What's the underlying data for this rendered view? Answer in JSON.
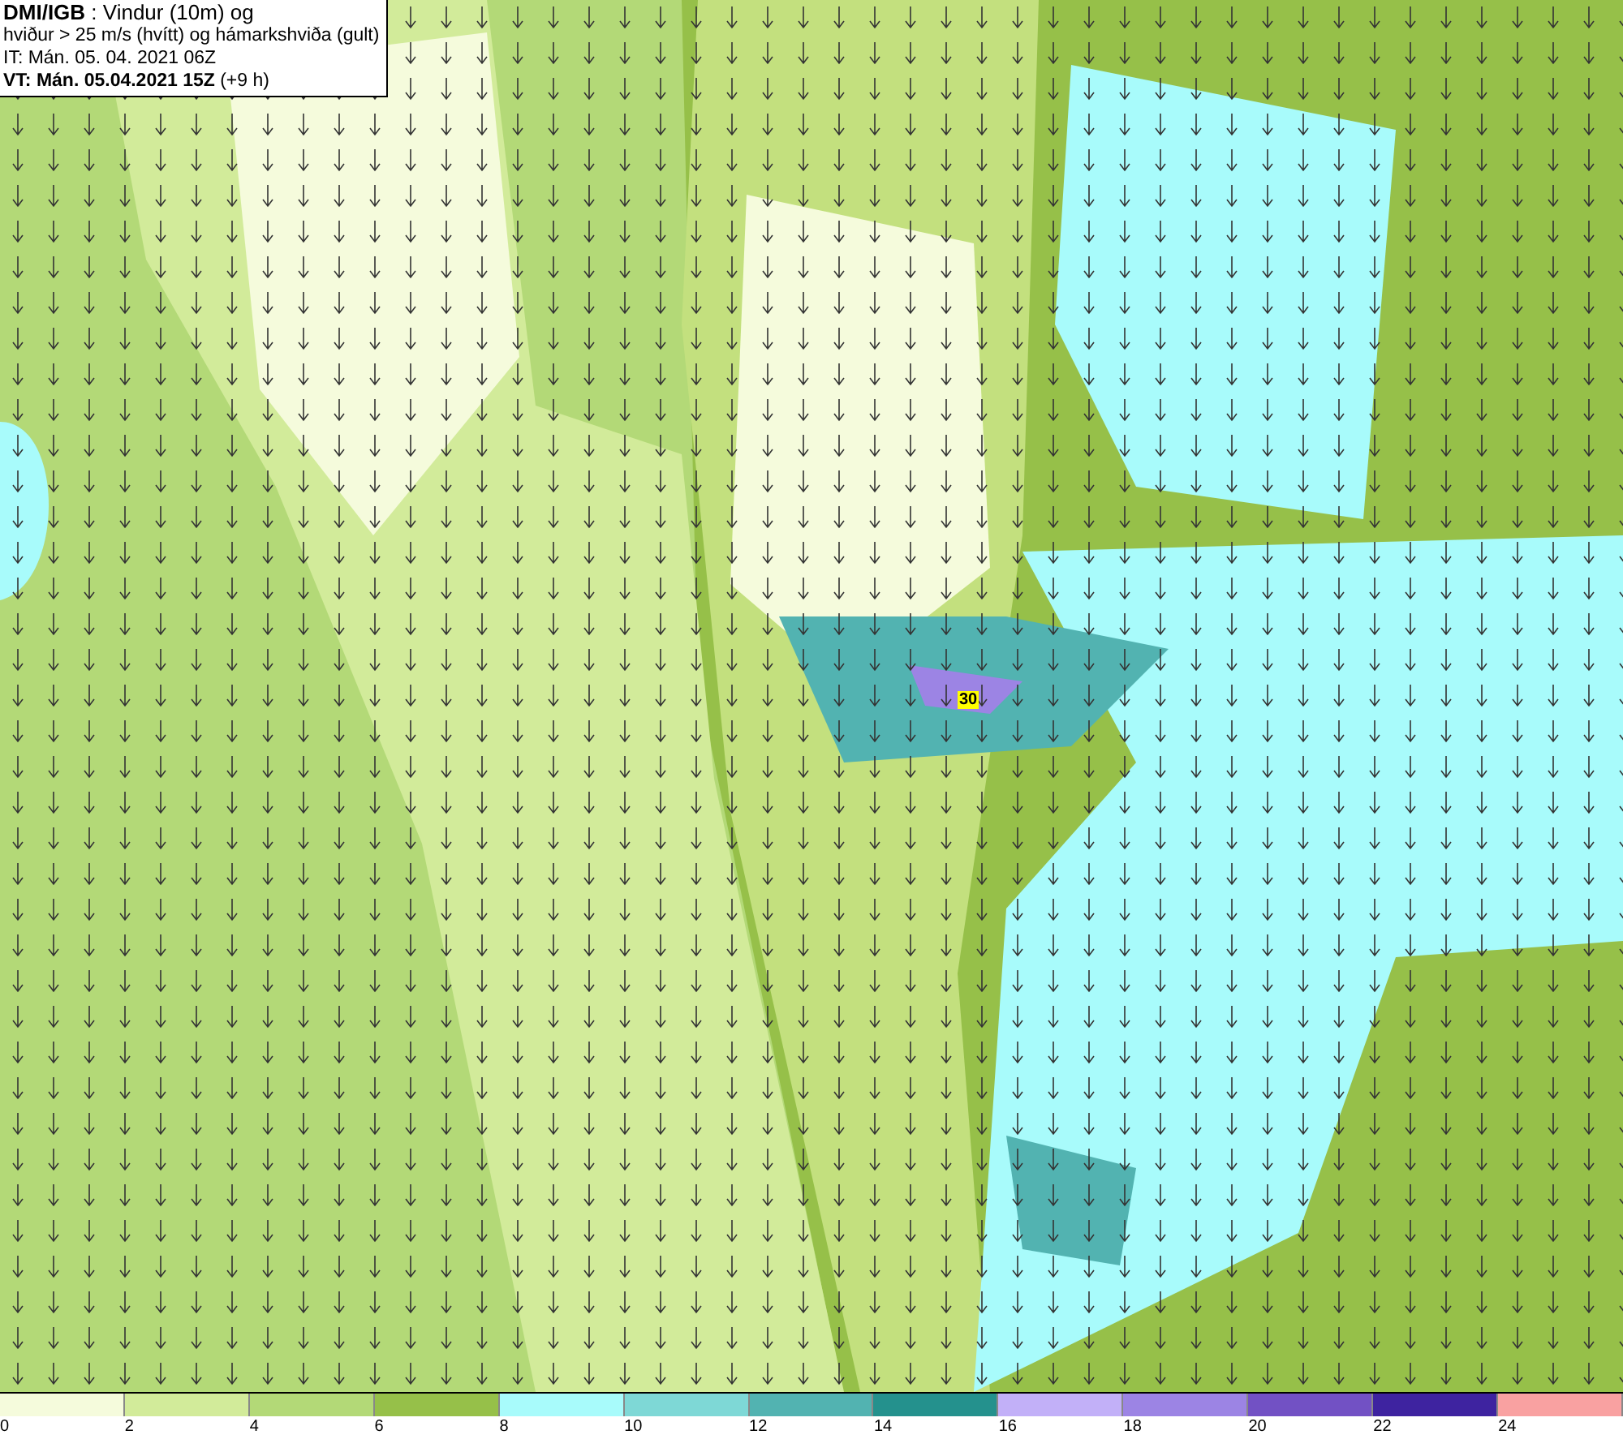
{
  "header": {
    "lines": [
      "**DMI/IGB** : Vindur (10m) og",
      "hviður > 25 m/s (hvítt) og hámarkshviða (gult)",
      "IT: Mán. 05. 04. 2021 06Z",
      "**VT: Mán. 05.04.2021 15Z** (+9 h)"
    ]
  },
  "map": {
    "gust_labels": [
      {
        "text": "30"
      }
    ]
  },
  "legend": {
    "bins": [
      {
        "label": "0",
        "color": "#f5fbdc"
      },
      {
        "label": "2",
        "color": "#d2eb9a"
      },
      {
        "label": "4",
        "color": "#b3d977"
      },
      {
        "label": "6",
        "color": "#96c049"
      },
      {
        "label": "8",
        "color": "#a8fbfb"
      },
      {
        "label": "10",
        "color": "#7ed8d6"
      },
      {
        "label": "12",
        "color": "#52b3b1"
      },
      {
        "label": "14",
        "color": "#24918d"
      },
      {
        "label": "16",
        "color": "#c2b0f8"
      },
      {
        "label": "18",
        "color": "#9c84e4"
      },
      {
        "label": "20",
        "color": "#7251c4"
      },
      {
        "label": "22",
        "color": "#3e23a0"
      },
      {
        "label": "24",
        "color": "#f9a1a1"
      }
    ]
  }
}
